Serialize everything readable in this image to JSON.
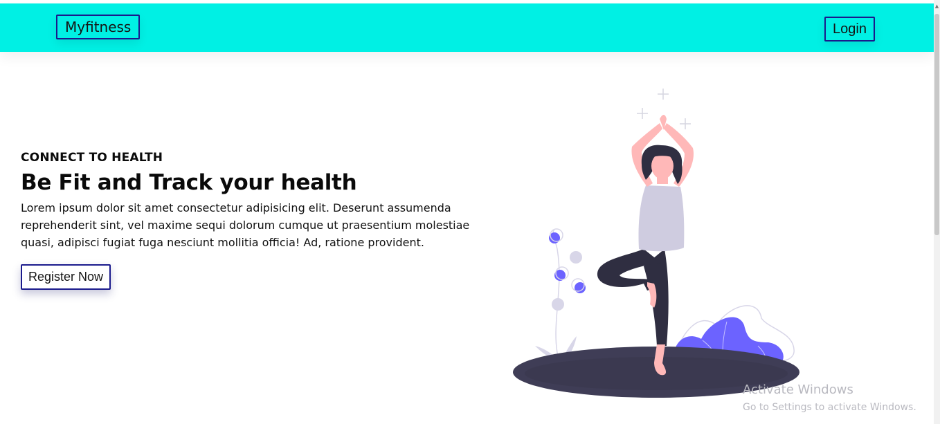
{
  "navbar": {
    "brand": "Myfitness",
    "login_label": "Login",
    "background_color": "#00f0e4"
  },
  "hero": {
    "eyebrow": "CONNECT TO HEALTH",
    "headline": "Be Fit and Track your health",
    "lead": "Lorem ipsum dolor sit amet consectetur adipisicing elit. Deserunt assumenda reprehenderit sint, vel maxime sequi dolorum cumque ut praesentium molestiae quasi, adipisci fugiat fuga nesciunt mollitia officia! Ad, ratione provident.",
    "register_label": "Register Now"
  },
  "illustration": {
    "icon": "yoga-woman-illustration",
    "accent_color": "#6c63ff",
    "platform_color": "#3f3d56"
  },
  "watermark": {
    "title": "Activate Windows",
    "subtitle": "Go to Settings to activate Windows."
  },
  "colors": {
    "button_border": "#1a1a8c",
    "text": "#0a0a0a"
  }
}
